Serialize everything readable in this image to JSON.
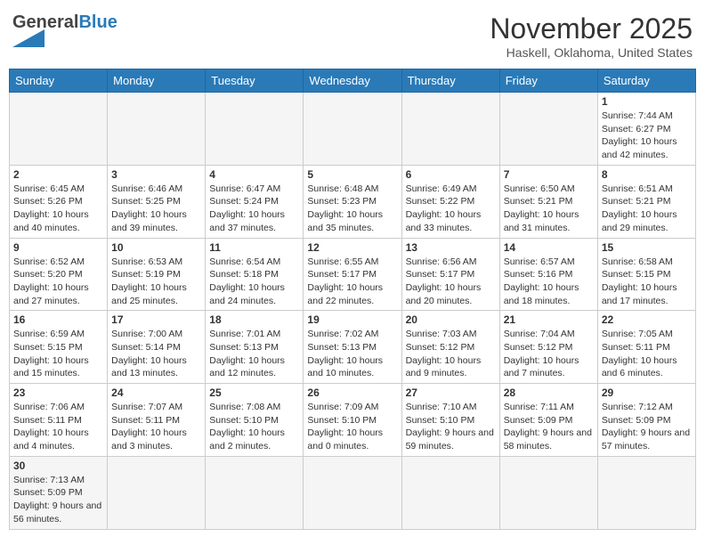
{
  "header": {
    "logo_general": "General",
    "logo_blue": "Blue",
    "month_title": "November 2025",
    "location": "Haskell, Oklahoma, United States"
  },
  "weekdays": [
    "Sunday",
    "Monday",
    "Tuesday",
    "Wednesday",
    "Thursday",
    "Friday",
    "Saturday"
  ],
  "weeks": [
    [
      {
        "day": "",
        "empty": true
      },
      {
        "day": "",
        "empty": true
      },
      {
        "day": "",
        "empty": true
      },
      {
        "day": "",
        "empty": true
      },
      {
        "day": "",
        "empty": true
      },
      {
        "day": "",
        "empty": true
      },
      {
        "day": "1",
        "sunrise": "7:44 AM",
        "sunset": "6:27 PM",
        "daylight": "10 hours and 42 minutes."
      }
    ],
    [
      {
        "day": "2",
        "sunrise": "6:45 AM",
        "sunset": "5:26 PM",
        "daylight": "10 hours and 40 minutes."
      },
      {
        "day": "3",
        "sunrise": "6:46 AM",
        "sunset": "5:25 PM",
        "daylight": "10 hours and 39 minutes."
      },
      {
        "day": "4",
        "sunrise": "6:47 AM",
        "sunset": "5:24 PM",
        "daylight": "10 hours and 37 minutes."
      },
      {
        "day": "5",
        "sunrise": "6:48 AM",
        "sunset": "5:23 PM",
        "daylight": "10 hours and 35 minutes."
      },
      {
        "day": "6",
        "sunrise": "6:49 AM",
        "sunset": "5:22 PM",
        "daylight": "10 hours and 33 minutes."
      },
      {
        "day": "7",
        "sunrise": "6:50 AM",
        "sunset": "5:21 PM",
        "daylight": "10 hours and 31 minutes."
      },
      {
        "day": "8",
        "sunrise": "6:51 AM",
        "sunset": "5:21 PM",
        "daylight": "10 hours and 29 minutes."
      }
    ],
    [
      {
        "day": "9",
        "sunrise": "6:52 AM",
        "sunset": "5:20 PM",
        "daylight": "10 hours and 27 minutes."
      },
      {
        "day": "10",
        "sunrise": "6:53 AM",
        "sunset": "5:19 PM",
        "daylight": "10 hours and 25 minutes."
      },
      {
        "day": "11",
        "sunrise": "6:54 AM",
        "sunset": "5:18 PM",
        "daylight": "10 hours and 24 minutes."
      },
      {
        "day": "12",
        "sunrise": "6:55 AM",
        "sunset": "5:17 PM",
        "daylight": "10 hours and 22 minutes."
      },
      {
        "day": "13",
        "sunrise": "6:56 AM",
        "sunset": "5:17 PM",
        "daylight": "10 hours and 20 minutes."
      },
      {
        "day": "14",
        "sunrise": "6:57 AM",
        "sunset": "5:16 PM",
        "daylight": "10 hours and 18 minutes."
      },
      {
        "day": "15",
        "sunrise": "6:58 AM",
        "sunset": "5:15 PM",
        "daylight": "10 hours and 17 minutes."
      }
    ],
    [
      {
        "day": "16",
        "sunrise": "6:59 AM",
        "sunset": "5:15 PM",
        "daylight": "10 hours and 15 minutes."
      },
      {
        "day": "17",
        "sunrise": "7:00 AM",
        "sunset": "5:14 PM",
        "daylight": "10 hours and 13 minutes."
      },
      {
        "day": "18",
        "sunrise": "7:01 AM",
        "sunset": "5:13 PM",
        "daylight": "10 hours and 12 minutes."
      },
      {
        "day": "19",
        "sunrise": "7:02 AM",
        "sunset": "5:13 PM",
        "daylight": "10 hours and 10 minutes."
      },
      {
        "day": "20",
        "sunrise": "7:03 AM",
        "sunset": "5:12 PM",
        "daylight": "10 hours and 9 minutes."
      },
      {
        "day": "21",
        "sunrise": "7:04 AM",
        "sunset": "5:12 PM",
        "daylight": "10 hours and 7 minutes."
      },
      {
        "day": "22",
        "sunrise": "7:05 AM",
        "sunset": "5:11 PM",
        "daylight": "10 hours and 6 minutes."
      }
    ],
    [
      {
        "day": "23",
        "sunrise": "7:06 AM",
        "sunset": "5:11 PM",
        "daylight": "10 hours and 4 minutes."
      },
      {
        "day": "24",
        "sunrise": "7:07 AM",
        "sunset": "5:11 PM",
        "daylight": "10 hours and 3 minutes."
      },
      {
        "day": "25",
        "sunrise": "7:08 AM",
        "sunset": "5:10 PM",
        "daylight": "10 hours and 2 minutes."
      },
      {
        "day": "26",
        "sunrise": "7:09 AM",
        "sunset": "5:10 PM",
        "daylight": "10 hours and 0 minutes."
      },
      {
        "day": "27",
        "sunrise": "7:10 AM",
        "sunset": "5:10 PM",
        "daylight": "9 hours and 59 minutes."
      },
      {
        "day": "28",
        "sunrise": "7:11 AM",
        "sunset": "5:09 PM",
        "daylight": "9 hours and 58 minutes."
      },
      {
        "day": "29",
        "sunrise": "7:12 AM",
        "sunset": "5:09 PM",
        "daylight": "9 hours and 57 minutes."
      }
    ],
    [
      {
        "day": "30",
        "sunrise": "7:13 AM",
        "sunset": "5:09 PM",
        "daylight": "9 hours and 56 minutes.",
        "last": true
      },
      {
        "day": "",
        "empty": true,
        "last": true
      },
      {
        "day": "",
        "empty": true,
        "last": true
      },
      {
        "day": "",
        "empty": true,
        "last": true
      },
      {
        "day": "",
        "empty": true,
        "last": true
      },
      {
        "day": "",
        "empty": true,
        "last": true
      },
      {
        "day": "",
        "empty": true,
        "last": true
      }
    ]
  ]
}
